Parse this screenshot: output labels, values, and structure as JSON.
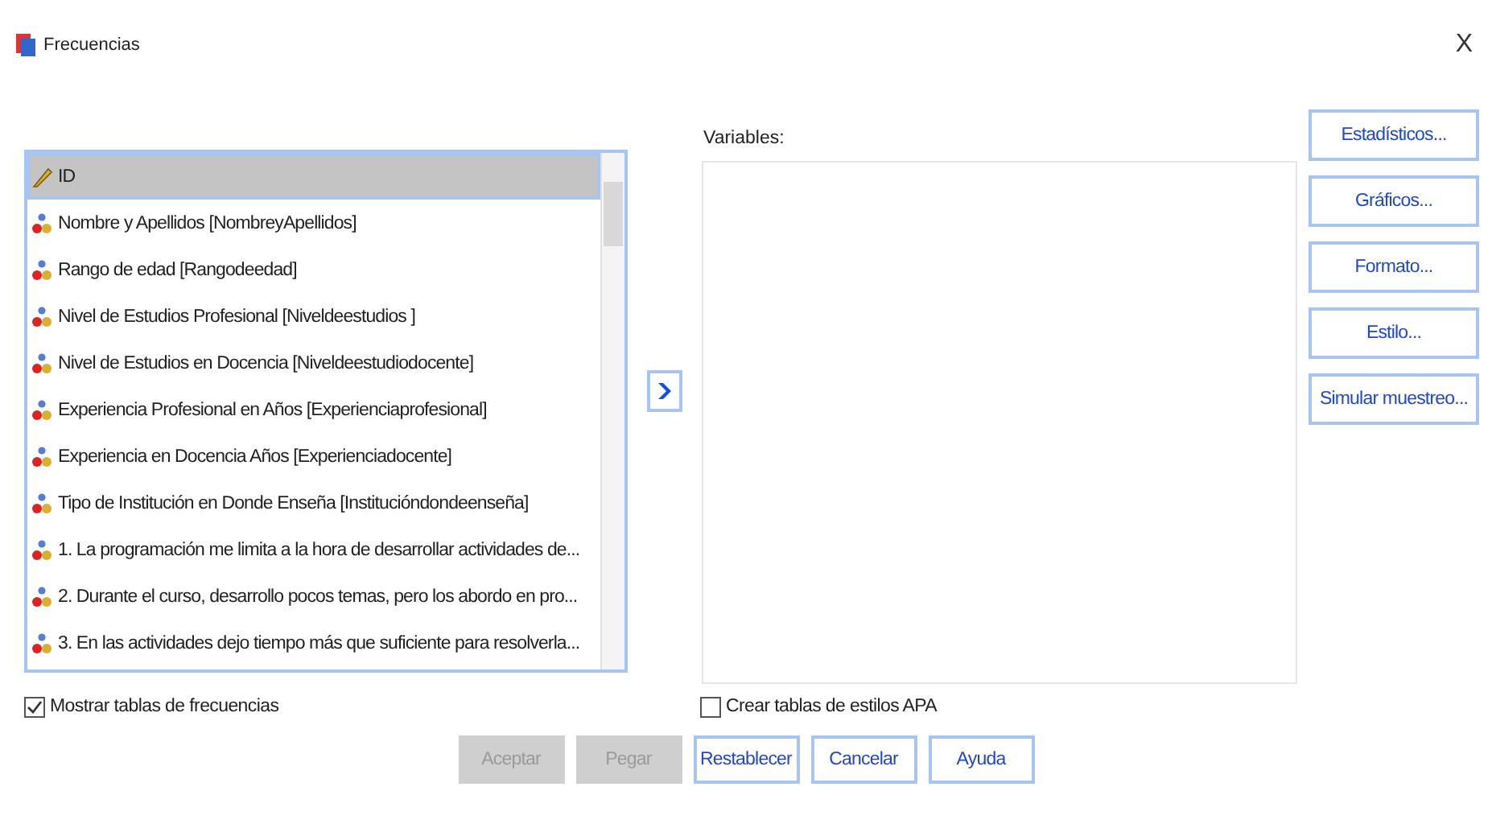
{
  "window": {
    "title": "Frecuencias",
    "close": "X"
  },
  "source_list": {
    "items": [
      {
        "label": "ID",
        "kind": "scale",
        "selected": true
      },
      {
        "label": "Nombre y Apellidos [NombreyApellidos]",
        "kind": "nominal",
        "selected": false
      },
      {
        "label": "Rango de edad [Rangodeedad]",
        "kind": "nominal",
        "selected": false
      },
      {
        "label": "Nivel de Estudios Profesional  [Niveldeestudios ]",
        "kind": "nominal",
        "selected": false
      },
      {
        "label": "Nivel de Estudios en Docencia [Niveldeestudiodocente]",
        "kind": "nominal",
        "selected": false
      },
      {
        "label": "Experiencia Profesional en Años [Experienciaprofesional]",
        "kind": "nominal",
        "selected": false
      },
      {
        "label": "Experiencia en Docencia Años [Experienciadocente]",
        "kind": "nominal",
        "selected": false
      },
      {
        "label": "Tipo de Institución en Donde Enseña [Institucióndondeenseña]",
        "kind": "nominal",
        "selected": false
      },
      {
        "label": "1. La programación me limita a la hora de desarrollar actividades de...",
        "kind": "nominal",
        "selected": false
      },
      {
        "label": "2. Durante el curso, desarrollo pocos temas, pero los abordo en pro...",
        "kind": "nominal",
        "selected": false
      },
      {
        "label": "3. En las actividades dejo tiempo más que suficiente para resolverla...",
        "kind": "nominal",
        "selected": false
      }
    ]
  },
  "variables": {
    "label": "Variables:"
  },
  "side_buttons": [
    "Estadísticos...",
    "Gráficos...",
    "Formato...",
    "Estilo...",
    "Simular muestreo..."
  ],
  "options": [
    {
      "label": "Mostrar tablas de frecuencias",
      "checked": true
    },
    {
      "label": "Crear tablas de estilos APA",
      "checked": false
    }
  ],
  "buttons": [
    {
      "label": "Aceptar",
      "disabled": true
    },
    {
      "label": "Pegar",
      "disabled": true
    },
    {
      "label": "Restablecer",
      "disabled": false
    },
    {
      "label": "Cancelar",
      "disabled": false
    },
    {
      "label": "Ayuda",
      "disabled": false
    }
  ]
}
